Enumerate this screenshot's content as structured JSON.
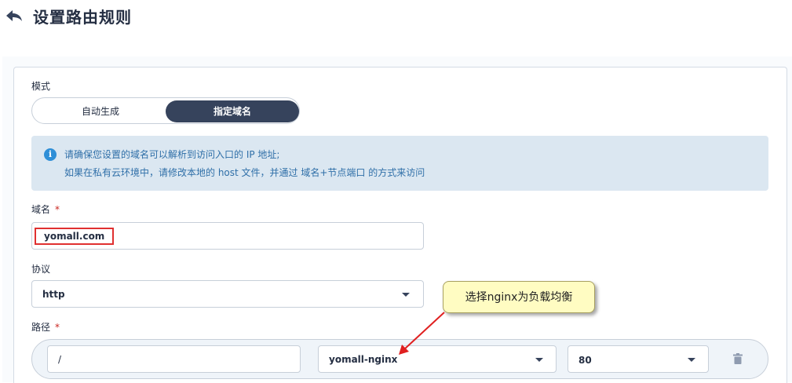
{
  "header": {
    "title": "设置路由规则",
    "back_icon": "back-arrow-icon"
  },
  "mode": {
    "label": "模式",
    "options": [
      "自动生成",
      "指定域名"
    ],
    "selected": "指定域名"
  },
  "info": {
    "icon": "info-icon",
    "icon_glyph": "i",
    "line1": "请确保您设置的域名可以解析到访问入口的 IP 地址;",
    "line2": "如果在私有云环境中，请修改本地的 host 文件，并通过 域名+节点端口 的方式来访问"
  },
  "domain": {
    "label": "域名",
    "required_mark": "*",
    "value": "yomall.com"
  },
  "protocol": {
    "label": "协议",
    "value": "http"
  },
  "path": {
    "label": "路径",
    "required_mark": "*",
    "path_value": "/",
    "service_value": "yomall-nginx",
    "port_value": "80"
  },
  "annotation": {
    "callout_text": "选择nginx为负载均衡",
    "accent_color": "#e02020"
  }
}
